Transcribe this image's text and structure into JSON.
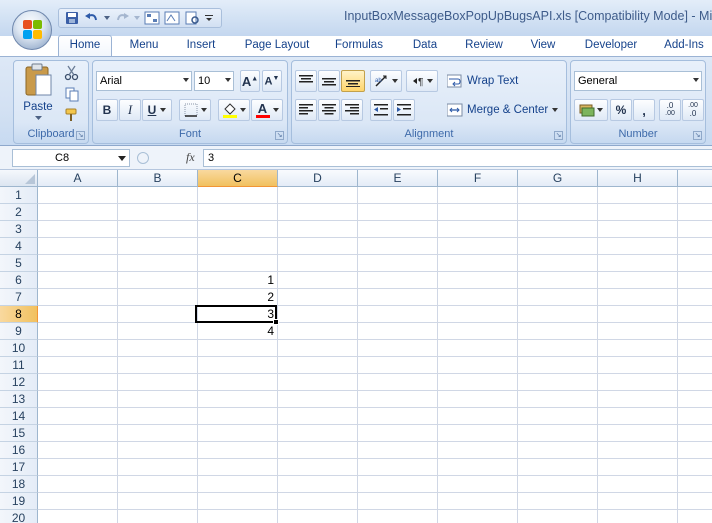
{
  "window": {
    "title": "InputBoxMessageBoxPopUpBugsAPI.xls  [Compatibility Mode] - Micro"
  },
  "tabs": [
    {
      "label": "Home"
    },
    {
      "label": "Menu"
    },
    {
      "label": "Insert"
    },
    {
      "label": "Page Layout"
    },
    {
      "label": "Formulas"
    },
    {
      "label": "Data"
    },
    {
      "label": "Review"
    },
    {
      "label": "View"
    },
    {
      "label": "Developer"
    },
    {
      "label": "Add-Ins"
    }
  ],
  "ribbon": {
    "clipboard": {
      "label": "Clipboard",
      "paste_label": "Paste"
    },
    "font": {
      "label": "Font",
      "font_name": "Arial",
      "font_size": "10",
      "bold": "B",
      "italic": "I",
      "underline": "U",
      "color_letter": "A"
    },
    "alignment": {
      "label": "Alignment",
      "wrap_text": "Wrap Text",
      "merge_center": "Merge & Center"
    },
    "number": {
      "label": "Number",
      "format": "General",
      "percent": "%",
      "comma": ",",
      "inc_decimal": ".0",
      "dec_decimal": ".00"
    }
  },
  "formula_bar": {
    "name_box": "C8",
    "fx_label": "fx",
    "formula": "3"
  },
  "grid": {
    "columns": [
      "A",
      "B",
      "C",
      "D",
      "E",
      "F",
      "G",
      "H"
    ],
    "rows": [
      "1",
      "2",
      "3",
      "4",
      "5",
      "6",
      "7",
      "8",
      "9",
      "10",
      "11",
      "12",
      "13",
      "14",
      "15",
      "16",
      "17",
      "18",
      "19",
      "20"
    ],
    "selected_column": "C",
    "selected_row": "8",
    "cells": {
      "C6": "1",
      "C7": "2",
      "C8": "3",
      "C9": "4"
    }
  },
  "colors": {
    "accent": "#15428b",
    "selection_header": "#f1c15f",
    "ribbon_bg": "#d3e1f3"
  }
}
